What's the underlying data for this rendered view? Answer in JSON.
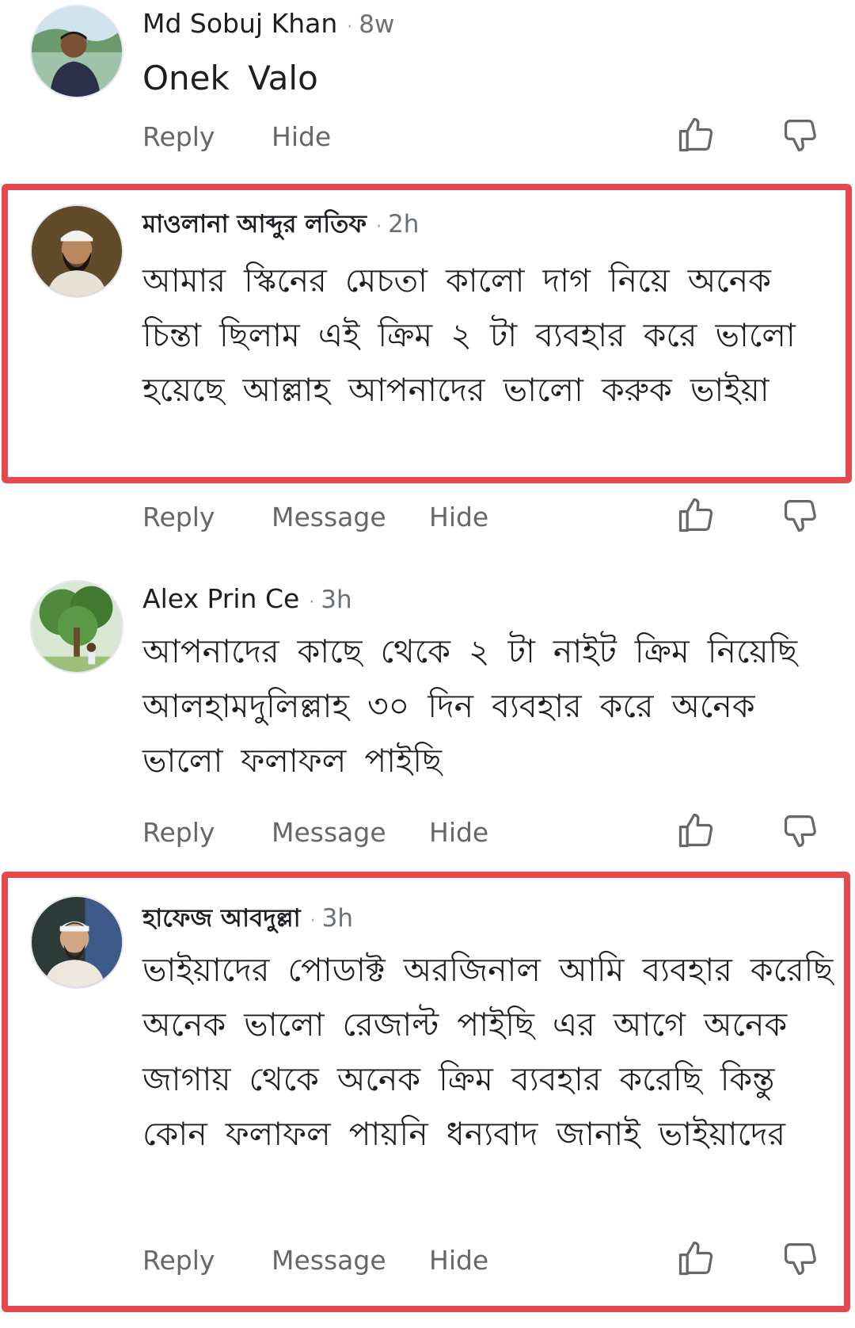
{
  "comments": [
    {
      "author": "Md Sobuj Khan",
      "time": "8w",
      "text": "Onek Valo",
      "actions": {
        "reply": "Reply",
        "hide": "Hide"
      }
    },
    {
      "author": "মাওলানা আব্দুর লতিফ",
      "time": "2h",
      "text": "আমার স্কিনের মেচতা কালো দাগ নিয়ে অনেক চিন্তা ছিলাম এই ক্রিম ২ টা ব্যবহার করে ভালো হয়েছে আল্লাহ আপনাদের ভালো করুক ভাইয়া",
      "actions": {
        "reply": "Reply",
        "message": "Message",
        "hide": "Hide"
      }
    },
    {
      "author": "Alex Prin Ce",
      "time": "3h",
      "text": "আপনাদের কাছে থেকে ২ টা নাইট ক্রিম নিয়েছি আলহামদুলিল্লাহ ৩০ দিন ব্যবহার করে অনেক ভালো ফলাফল পাইছি",
      "actions": {
        "reply": "Reply",
        "message": "Message",
        "hide": "Hide"
      }
    },
    {
      "author": "হাফেজ আবদুল্লা",
      "time": "3h",
      "text": "ভাইয়াদের পোডাক্ট অরজিনাল আমি ব্যবহার করেছি অনেক ভালো রেজাল্ট পাইছি এর আগে অনেক জাগায় থেকে অনেক ক্রিম ব্যবহার করেছি কিন্তু কোন ফলাফল পায়নি ধন্যবাদ জানাই ভাইয়াদের",
      "actions": {
        "reply": "Reply",
        "message": "Message",
        "hide": "Hide"
      }
    }
  ],
  "colors": {
    "highlight_border": "#e5484d",
    "action_text": "#65676b",
    "timestamp": "#6b6f76"
  },
  "icons": {
    "like": "thumbs-up-icon",
    "dislike": "thumbs-down-icon"
  }
}
